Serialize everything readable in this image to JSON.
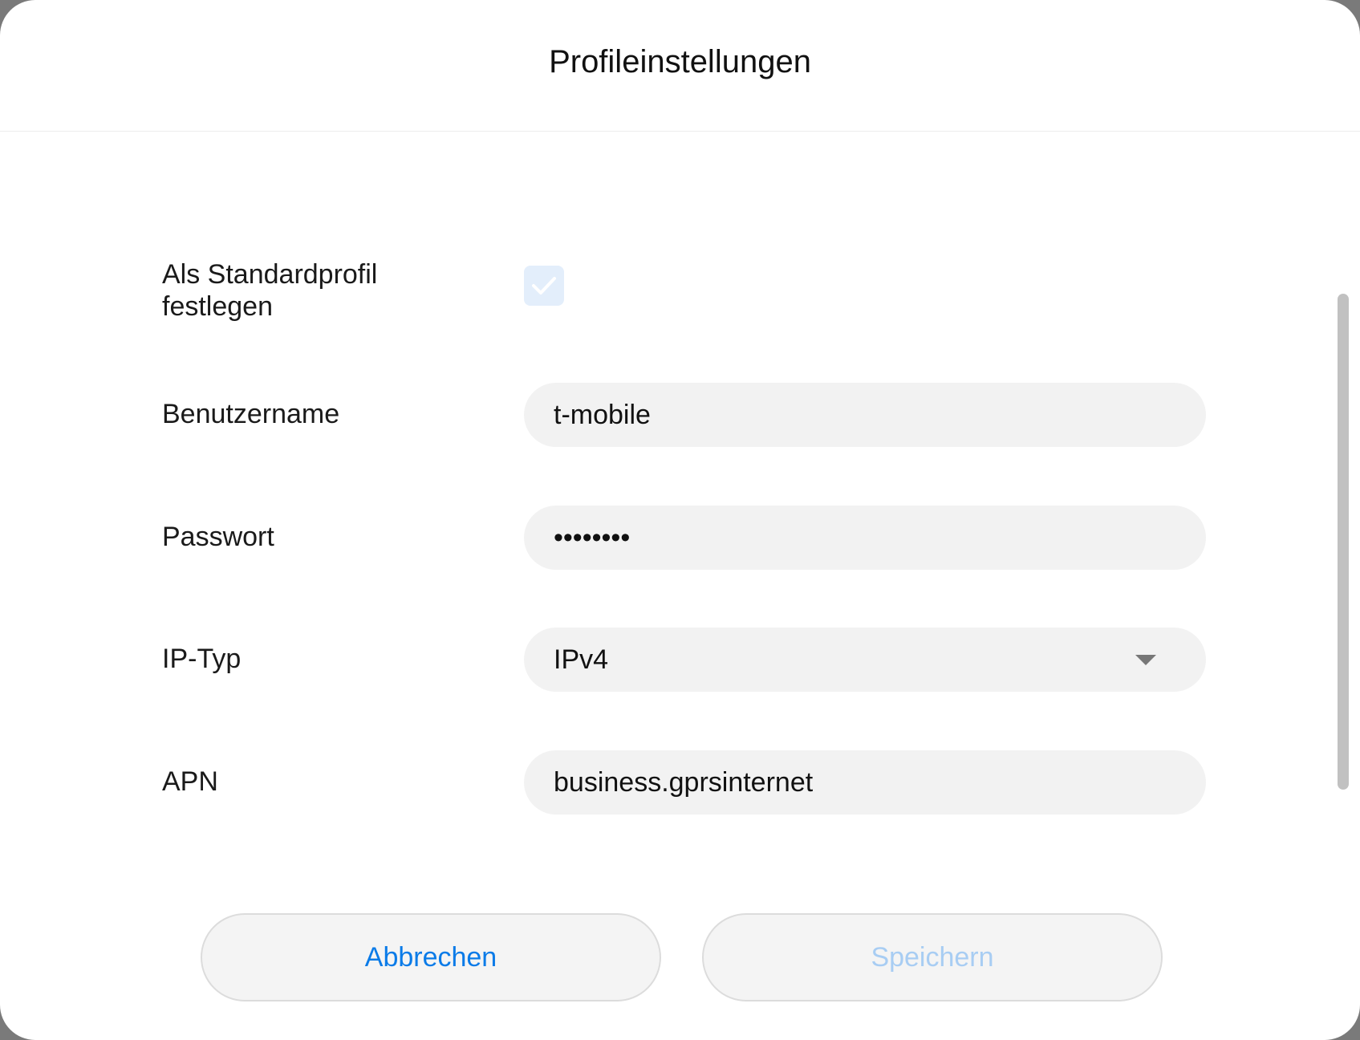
{
  "dialog": {
    "title": "Profileinstellungen"
  },
  "form": {
    "default_profile": {
      "label_line1": "Als Standardprofil",
      "label_line2": "festlegen",
      "checked": true
    },
    "username": {
      "label": "Benutzername",
      "value": "t-mobile"
    },
    "password": {
      "label": "Passwort",
      "value": "••••••••"
    },
    "ip_type": {
      "label": "IP-Typ",
      "value": "IPv4"
    },
    "apn": {
      "label": "APN",
      "value": "business.gprsinternet"
    }
  },
  "buttons": {
    "cancel": "Abbrechen",
    "save": "Speichern"
  },
  "colors": {
    "accent": "#0a7be8",
    "disabled_accent": "#a8cdf3",
    "field_bg": "#f2f2f2"
  },
  "icons": {
    "checkbox": "check-icon",
    "dropdown": "chevron-down-icon"
  }
}
